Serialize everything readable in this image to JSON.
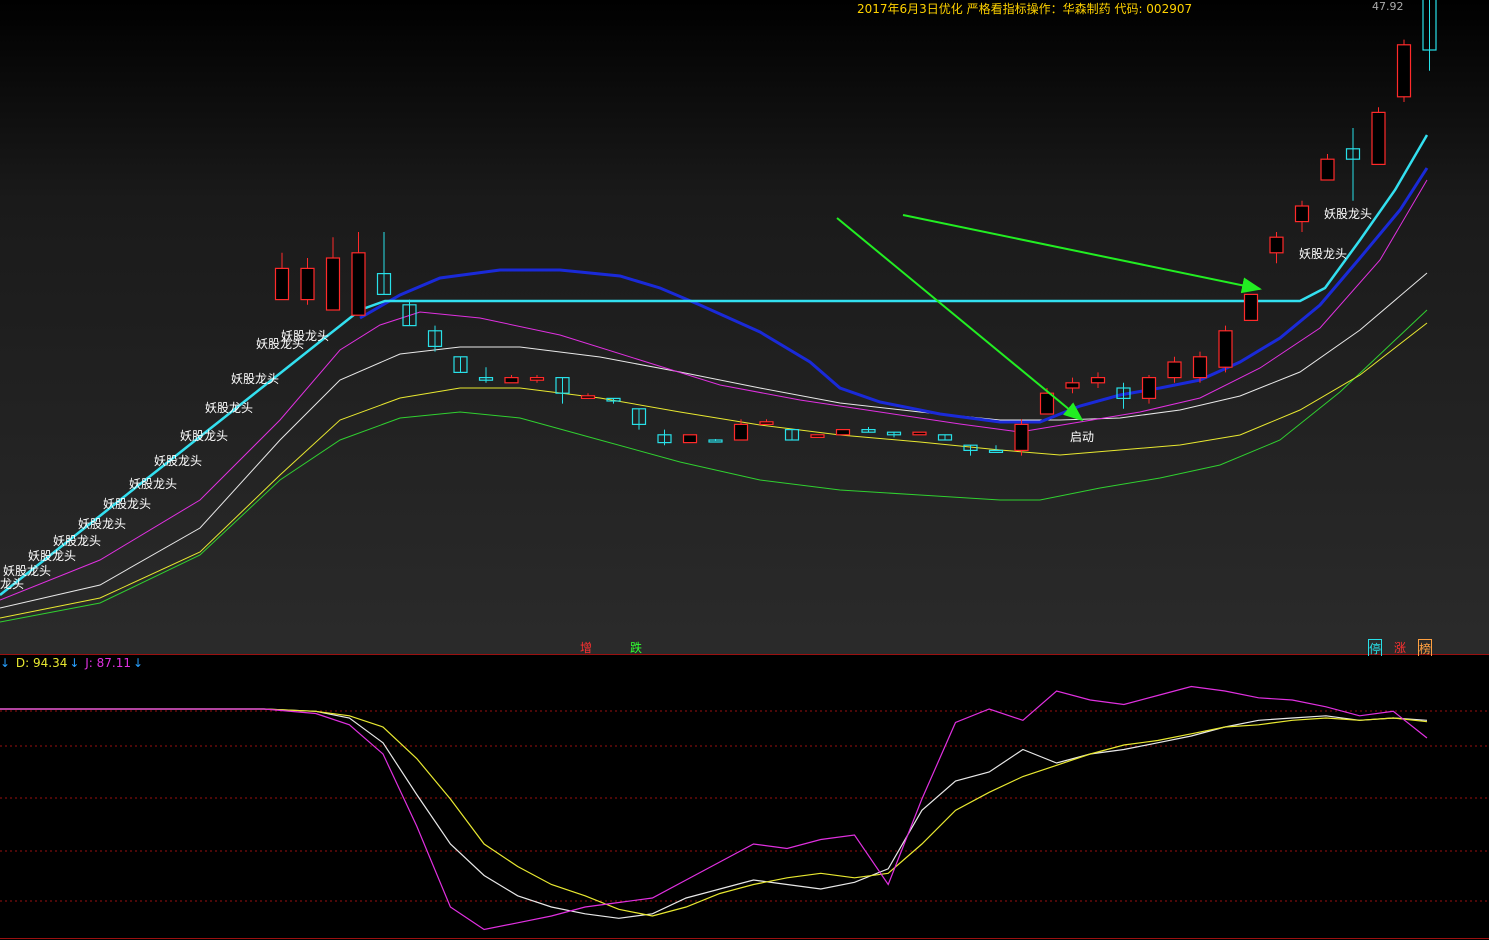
{
  "title": "2017年6月3日优化 严格看指标操作：华森制药 代码: 002907",
  "price_top": "47.92",
  "colors": {
    "up": "#ff2a2a",
    "down": "#28e0e8",
    "cyan_line": "#33e0f0",
    "blue_line": "#1a2ad8",
    "magenta": "#e030e0",
    "white": "#e8e8e8",
    "yellow": "#e8e830",
    "green": "#30d030",
    "arrow": "#22ee22",
    "grid_red": "#9a1010"
  },
  "legend": {
    "d_arrow": "↓",
    "d_label": "D: 94.34",
    "d_arrow2": "↓",
    "j_label": "J: 87.11",
    "j_arrow": "↓"
  },
  "panel_tags": {
    "zeng": "增",
    "die": "跌",
    "ting": "停",
    "zhang": "涨",
    "bang": "榜"
  },
  "signal_text": "妖股龙头",
  "signal_text_clipped": "龙头",
  "start_text": "启动",
  "chart_data": [
    {
      "type": "candlestick",
      "y_range": [
        0,
        100
      ],
      "price_top_label": "47.92",
      "candles": [
        {
          "i": 0,
          "o": 62,
          "c": 68,
          "h": 71,
          "l": 62,
          "dir": "up"
        },
        {
          "i": 1,
          "o": 62,
          "c": 68,
          "h": 70,
          "l": 61,
          "dir": "up"
        },
        {
          "i": 2,
          "o": 60,
          "c": 70,
          "h": 74,
          "l": 60,
          "dir": "up"
        },
        {
          "i": 3,
          "o": 59,
          "c": 71,
          "h": 75,
          "l": 59,
          "dir": "up"
        },
        {
          "i": 4,
          "o": 67,
          "c": 63,
          "h": 75,
          "l": 63,
          "dir": "down"
        },
        {
          "i": 5,
          "o": 61,
          "c": 57,
          "h": 62,
          "l": 57,
          "dir": "down"
        },
        {
          "i": 6,
          "o": 56,
          "c": 53,
          "h": 57,
          "l": 52,
          "dir": "down"
        },
        {
          "i": 7,
          "o": 51,
          "c": 48,
          "h": 51,
          "l": 48,
          "dir": "down"
        },
        {
          "i": 8,
          "o": 47,
          "c": 46.5,
          "h": 49,
          "l": 46,
          "dir": "down"
        },
        {
          "i": 9,
          "o": 46,
          "c": 47,
          "h": 47.5,
          "l": 46,
          "dir": "up"
        },
        {
          "i": 10,
          "o": 46.5,
          "c": 47,
          "h": 47.5,
          "l": 46,
          "dir": "up"
        },
        {
          "i": 11,
          "o": 47,
          "c": 44,
          "h": 47,
          "l": 42,
          "dir": "down"
        },
        {
          "i": 12,
          "o": 43.5,
          "c": 43,
          "h": 44,
          "l": 43,
          "dir": "up"
        },
        {
          "i": 13,
          "o": 43,
          "c": 42.5,
          "h": 43,
          "l": 42,
          "dir": "down"
        },
        {
          "i": 14,
          "o": 41,
          "c": 38,
          "h": 41,
          "l": 37,
          "dir": "down"
        },
        {
          "i": 15,
          "o": 36,
          "c": 34.5,
          "h": 37,
          "l": 34,
          "dir": "down"
        },
        {
          "i": 16,
          "o": 34.5,
          "c": 36,
          "h": 36,
          "l": 34.5,
          "dir": "up"
        },
        {
          "i": 17,
          "o": 35,
          "c": 34.8,
          "h": 35.2,
          "l": 34.8,
          "dir": "down"
        },
        {
          "i": 18,
          "o": 35,
          "c": 38,
          "h": 39,
          "l": 35,
          "dir": "up"
        },
        {
          "i": 19,
          "o": 38,
          "c": 38.5,
          "h": 39,
          "l": 38,
          "dir": "up"
        },
        {
          "i": 20,
          "o": 37,
          "c": 35,
          "h": 37,
          "l": 35,
          "dir": "down"
        },
        {
          "i": 21,
          "o": 35.5,
          "c": 36,
          "h": 36,
          "l": 35.5,
          "dir": "up"
        },
        {
          "i": 22,
          "o": 36,
          "c": 37,
          "h": 37,
          "l": 36,
          "dir": "up"
        },
        {
          "i": 23,
          "o": 37,
          "c": 36.5,
          "h": 37.5,
          "l": 36.5,
          "dir": "down"
        },
        {
          "i": 24,
          "o": 36.5,
          "c": 36,
          "h": 36.5,
          "l": 35.5,
          "dir": "down"
        },
        {
          "i": 25,
          "o": 36,
          "c": 36.5,
          "h": 36.5,
          "l": 36,
          "dir": "up"
        },
        {
          "i": 26,
          "o": 36,
          "c": 35,
          "h": 36,
          "l": 35,
          "dir": "down"
        },
        {
          "i": 27,
          "o": 34,
          "c": 33,
          "h": 34,
          "l": 32,
          "dir": "down"
        },
        {
          "i": 28,
          "o": 33,
          "c": 33,
          "h": 34,
          "l": 33,
          "dir": "down"
        },
        {
          "i": 29,
          "o": 33,
          "c": 38,
          "h": 39,
          "l": 32,
          "dir": "up"
        },
        {
          "i": 30,
          "o": 40,
          "c": 44,
          "h": 45,
          "l": 40,
          "dir": "up"
        },
        {
          "i": 31,
          "o": 45,
          "c": 46,
          "h": 47,
          "l": 44,
          "dir": "up"
        },
        {
          "i": 32,
          "o": 46,
          "c": 47,
          "h": 48,
          "l": 45,
          "dir": "up"
        },
        {
          "i": 33,
          "o": 45,
          "c": 43,
          "h": 46,
          "l": 41,
          "dir": "down"
        },
        {
          "i": 34,
          "o": 43,
          "c": 47,
          "h": 47.5,
          "l": 42,
          "dir": "up"
        },
        {
          "i": 35,
          "o": 47,
          "c": 50,
          "h": 51,
          "l": 46,
          "dir": "up"
        },
        {
          "i": 36,
          "o": 47,
          "c": 51,
          "h": 52,
          "l": 46,
          "dir": "up"
        },
        {
          "i": 37,
          "o": 49,
          "c": 56,
          "h": 57,
          "l": 48,
          "dir": "up"
        },
        {
          "i": 38,
          "o": 58,
          "c": 63,
          "h": 63,
          "l": 58,
          "dir": "up"
        },
        {
          "i": 39,
          "o": 71,
          "c": 74,
          "h": 75,
          "l": 69,
          "dir": "up"
        },
        {
          "i": 40,
          "o": 77,
          "c": 80,
          "h": 81,
          "l": 75,
          "dir": "up"
        },
        {
          "i": 41,
          "o": 85,
          "c": 89,
          "h": 90,
          "l": 85,
          "dir": "up"
        },
        {
          "i": 42,
          "o": 89,
          "c": 91,
          "h": 95,
          "l": 81,
          "dir": "down"
        },
        {
          "i": 43,
          "o": 88,
          "c": 98,
          "h": 99,
          "l": 88,
          "dir": "up"
        },
        {
          "i": 44,
          "o": 101,
          "c": 111,
          "h": 112,
          "l": 100,
          "dir": "up"
        },
        {
          "i": 45,
          "o": 120,
          "c": 110,
          "h": 125,
          "l": 106,
          "dir": "down"
        }
      ],
      "signal_label_indices": [
        1,
        2,
        3,
        4,
        5,
        6,
        7,
        8,
        9,
        10,
        11,
        12,
        42,
        43
      ],
      "start_label_index": 33
    },
    {
      "type": "line",
      "name_labels": [
        "D: 94.34",
        "J: 87.11"
      ],
      "y_range": [
        0,
        100
      ],
      "series": [
        {
          "key": "K",
          "color": "white",
          "values": [
            100,
            100,
            100,
            100,
            100,
            100,
            100,
            100,
            100,
            100,
            100,
            100,
            99,
            96,
            85,
            62,
            40,
            26,
            17,
            12,
            9,
            7,
            9,
            16,
            20,
            24,
            22,
            20,
            23,
            29,
            55,
            68,
            72,
            82,
            76,
            80,
            82,
            85,
            88,
            92,
            95,
            96,
            97,
            95,
            96,
            95
          ]
        },
        {
          "key": "D",
          "color": "yellow",
          "values": [
            100,
            100,
            100,
            100,
            100,
            100,
            100,
            100,
            100,
            100,
            100,
            100,
            99,
            97,
            92,
            78,
            60,
            40,
            30,
            22,
            17,
            11,
            8,
            12,
            18,
            22,
            25,
            27,
            25,
            27,
            40,
            55,
            63,
            70,
            75,
            80,
            84,
            86,
            89,
            92,
            93,
            95,
            96,
            95,
            96,
            94.34
          ]
        },
        {
          "key": "J",
          "color": "magenta",
          "values": [
            100,
            100,
            100,
            100,
            100,
            100,
            100,
            100,
            100,
            100,
            100,
            100,
            98,
            93,
            80,
            48,
            12,
            2,
            5,
            8,
            12,
            14,
            16,
            24,
            32,
            40,
            38,
            42,
            44,
            22,
            60,
            94,
            100,
            95,
            108,
            104,
            102,
            106,
            110,
            108,
            105,
            104,
            101,
            97,
            99,
            87.11
          ]
        }
      ],
      "grid_lines": 6
    }
  ]
}
